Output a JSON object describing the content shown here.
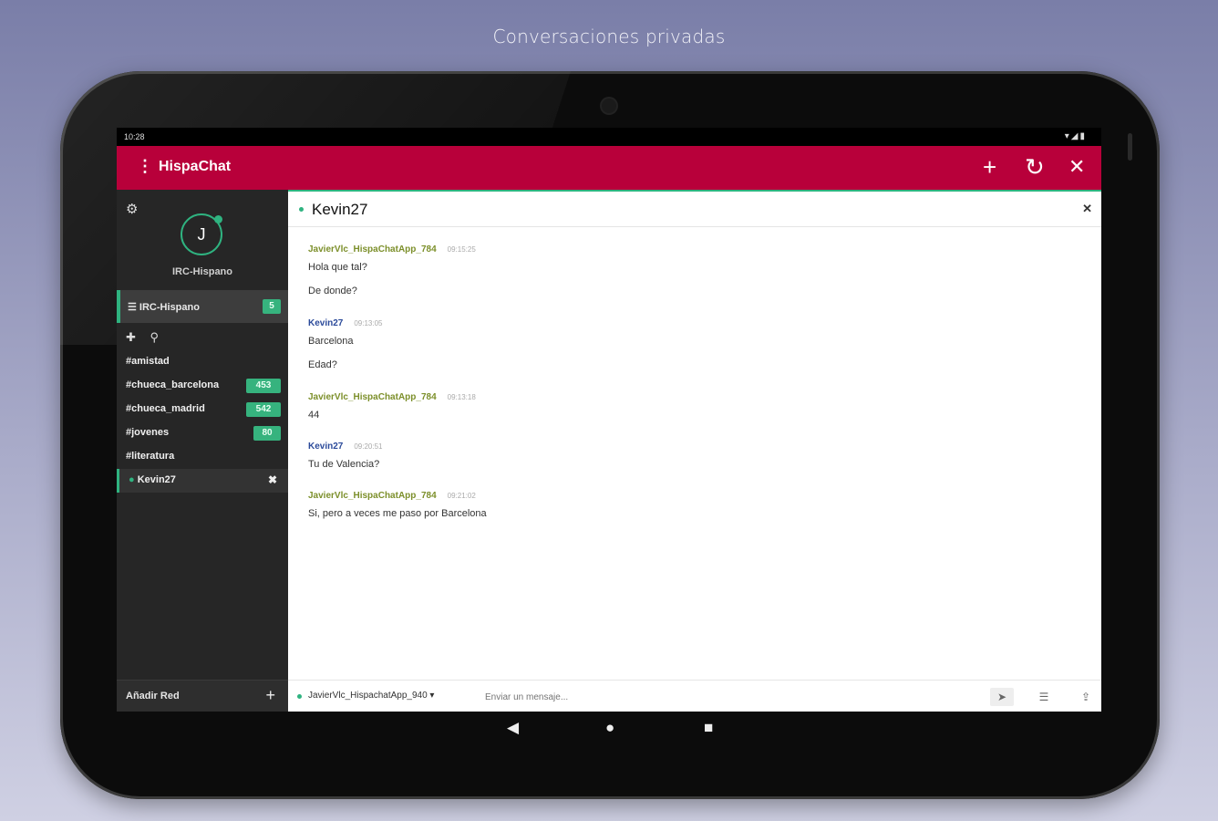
{
  "caption": "Conversaciones privadas",
  "status": {
    "time": "10:28",
    "icons": "▾◢▮"
  },
  "toolbar": {
    "menu_icon": "⋮",
    "title": "HispaChat",
    "add": "+",
    "refresh": "↻",
    "close": "✕"
  },
  "sidebar": {
    "avatar_letter": "J",
    "network": "IRC-Hispano",
    "network_row_label": "IRC-Hispano",
    "network_badge": "5",
    "channels": [
      {
        "name": "#amistad",
        "badge": ""
      },
      {
        "name": "#chueca_barcelona",
        "badge": "453"
      },
      {
        "name": "#chueca_madrid",
        "badge": "542"
      },
      {
        "name": "#jovenes",
        "badge": "80"
      },
      {
        "name": "#literatura",
        "badge": ""
      },
      {
        "name": "Kevin27",
        "badge": ""
      }
    ],
    "active_channel_prefix": "●",
    "active_close": "✖",
    "add_network": "Añadir Red",
    "add_plus": "+"
  },
  "chat": {
    "title": "Kevin27",
    "close": "✕",
    "messages": [
      {
        "author": "JavierVlc_HispaChatApp_784",
        "time": "09:15:25",
        "color": "#7c8f2a",
        "lines": [
          "Hola que tal?",
          "De donde?"
        ]
      },
      {
        "author": "Kevin27",
        "time": "09:13:05",
        "color": "#2b4a9a",
        "lines": [
          "Barcelona",
          "Edad?"
        ]
      },
      {
        "author": "JavierVlc_HispaChatApp_784",
        "time": "09:13:18",
        "color": "#7c8f2a",
        "lines": [
          "44"
        ]
      },
      {
        "author": "Kevin27",
        "time": "09:20:51",
        "color": "#2b4a9a",
        "lines": [
          "Tu de Valencia?"
        ]
      },
      {
        "author": "JavierVlc_HispaChatApp_784",
        "time": "09:21:02",
        "color": "#7c8f2a",
        "lines": [
          "Si, pero a veces me paso por Barcelona"
        ]
      }
    ]
  },
  "composer": {
    "nick": "JavierVlc_HispachatApp_940",
    "placeholder": "Enviar un mensaje...",
    "send_icon": "➤",
    "list_icon": "☰",
    "upload_icon": "⇪"
  },
  "navbar": {
    "back": "◀",
    "home": "●",
    "recents": "■"
  }
}
